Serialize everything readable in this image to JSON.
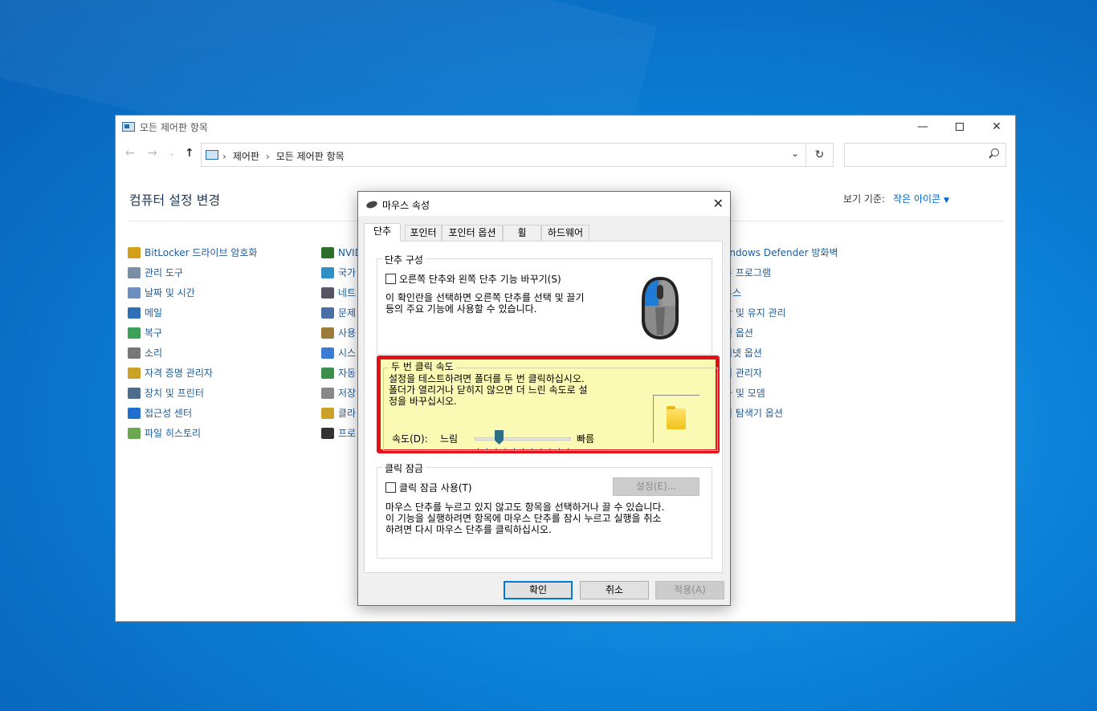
{
  "control_panel": {
    "title": "모든 제어판 항목",
    "address": {
      "segments": [
        "제어판",
        "모든 제어판 항목"
      ]
    },
    "search_placeholder": "",
    "heading": "컴퓨터 설정 변경",
    "view_by_label": "보기 기준:",
    "view_by_value": "작은 아이콘",
    "columns": [
      [
        "BitLocker 드라이브 암호화",
        "관리 도구",
        "날짜 및 시간",
        "메일",
        "복구",
        "소리",
        "자격 증명 관리자",
        "장치 및 프린터",
        "접근성 센터",
        "파일 히스토리"
      ],
      [
        "NVID",
        "국가",
        "네트",
        "문제",
        "사용",
        "시스",
        "자동",
        "저장",
        "클라",
        "프로"
      ],
      [
        "/indows Defender 방화벽",
        "본 프로그램",
        "우스",
        "안 및 유지 관리",
        "인 옵션",
        "터넷 옵션",
        "치 관리자",
        "화 및 모뎀",
        "일 탐색기 옵션"
      ]
    ]
  },
  "dialog": {
    "title": "마우스 속성",
    "tabs": [
      "단추",
      "포인터",
      "포인터 옵션",
      "휠",
      "하드웨어"
    ],
    "button_config": {
      "group_label": "단추 구성",
      "checkbox_label": "오른쪽 단추와 왼쪽 단추 기능 바꾸기(S)",
      "description": [
        "이 확인란을 선택하면 오른쪽 단추를 선택 및 끌기",
        "등의 주요 기능에 사용할 수 있습니다."
      ]
    },
    "double_click": {
      "group_label": "두 번 클릭 속도",
      "description": [
        "설정을 테스트하려면 폴더를 두 번 클릭하십시오.",
        "폴더가 열리거나 닫히지 않으면 더 느린 속도로 설",
        "정을 바꾸십시오."
      ],
      "speed_label": "속도(D):",
      "slow_label": "느림",
      "fast_label": "빠름",
      "speed_fraction": 0.25
    },
    "click_lock": {
      "group_label": "클릭 잠금",
      "checkbox_label": "클릭 잠금 사용(T)",
      "settings_button": "설정(E)...",
      "description": [
        "마우스 단추를 누르고 있지 않고도 항목을 선택하거나 끌 수 있습니다.",
        "이 기능을 실행하려면 항목에 마우스 단추를 잠시 누르고 실행을 취소",
        "하려면 다시 마우스 단추를 클릭하십시오."
      ]
    },
    "buttons": {
      "ok": "확인",
      "cancel": "취소",
      "apply": "적용(A)"
    }
  }
}
